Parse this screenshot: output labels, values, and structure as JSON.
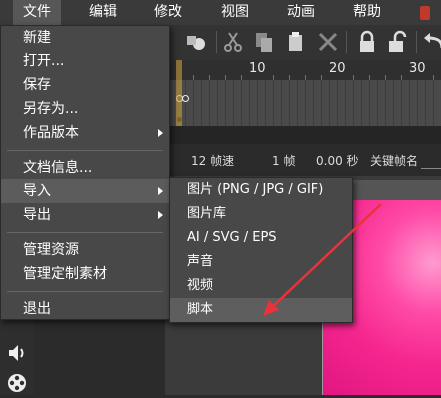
{
  "menubar": {
    "items": [
      "文件",
      "编辑",
      "修改",
      "视图",
      "动画",
      "帮助"
    ]
  },
  "timeline": {
    "ruler_numbers": [
      "10",
      "20",
      "30"
    ]
  },
  "status": {
    "fps": "12 帧速",
    "frame": "1 帧",
    "time": "0.00 秒",
    "keyframe_name": "关键帧名"
  },
  "file_menu": {
    "items": [
      {
        "label": "新建"
      },
      {
        "label": "打开..."
      },
      {
        "label": "保存"
      },
      {
        "label": "另存为..."
      },
      {
        "label": "作品版本"
      },
      {
        "label": "文档信息..."
      },
      {
        "label": "导入"
      },
      {
        "label": "导出"
      },
      {
        "label": "管理资源"
      },
      {
        "label": "管理定制素材"
      },
      {
        "label": "退出"
      }
    ]
  },
  "import_submenu": {
    "items": [
      {
        "label": "图片 (PNG / JPG / GIF)"
      },
      {
        "label": "图片库"
      },
      {
        "label": "AI / SVG / EPS"
      },
      {
        "label": "声音"
      },
      {
        "label": "视频"
      },
      {
        "label": "脚本"
      }
    ]
  },
  "colors": {
    "annotation_arrow": "#e8333a",
    "canvas_pink": "#f5268e",
    "playhead": "#d6a840"
  },
  "icons": [
    "cut-icon",
    "copy-icon",
    "paste-icon",
    "delete-icon",
    "lock-icon",
    "unlock-icon",
    "undo-icon",
    "sound-icon",
    "film-reel-icon"
  ]
}
